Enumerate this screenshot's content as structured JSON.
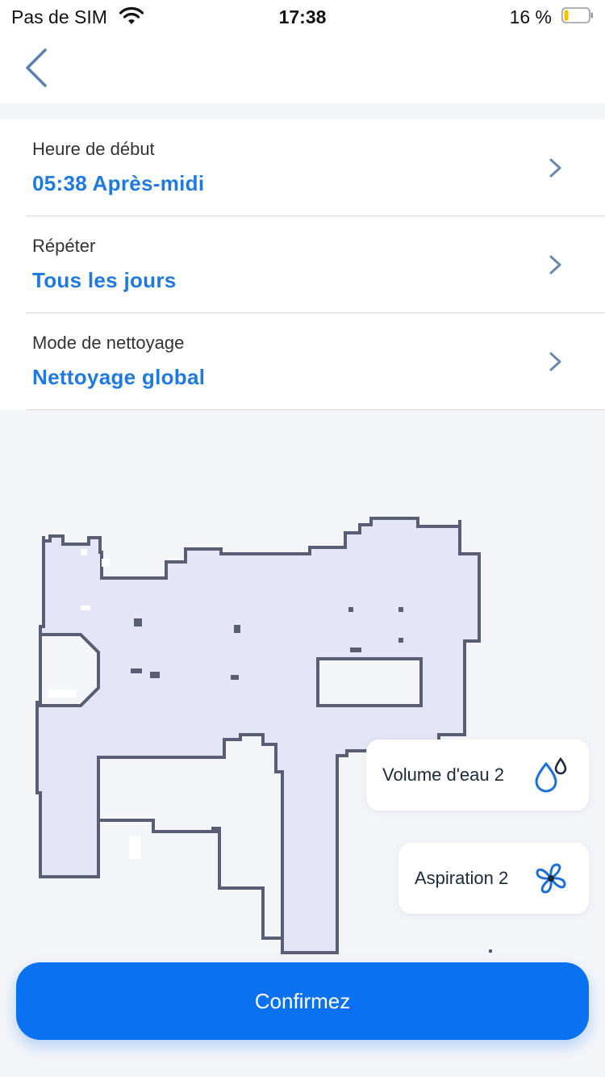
{
  "status_bar": {
    "carrier": "Pas de SIM",
    "time": "17:38",
    "battery": "16 %",
    "battery_level": 0.16
  },
  "nav": {
    "back_icon": "chevron-left-icon"
  },
  "settings": [
    {
      "label": "Heure de début",
      "value": "05:38 Après-midi"
    },
    {
      "label": "Répéter",
      "value": "Tous les jours"
    },
    {
      "label": "Mode de nettoyage",
      "value": "Nettoyage global"
    }
  ],
  "chips": {
    "water": {
      "label": "Volume d'eau 2",
      "icon": "water-drop-icon"
    },
    "suction": {
      "label": "Aspiration 2",
      "icon": "fan-icon"
    }
  },
  "confirm_label": "Confirmez",
  "colors": {
    "accent": "#1f7ae0",
    "button": "#0a72f0",
    "map_fill": "#e4e5f6",
    "map_wall": "#5b5e73"
  }
}
